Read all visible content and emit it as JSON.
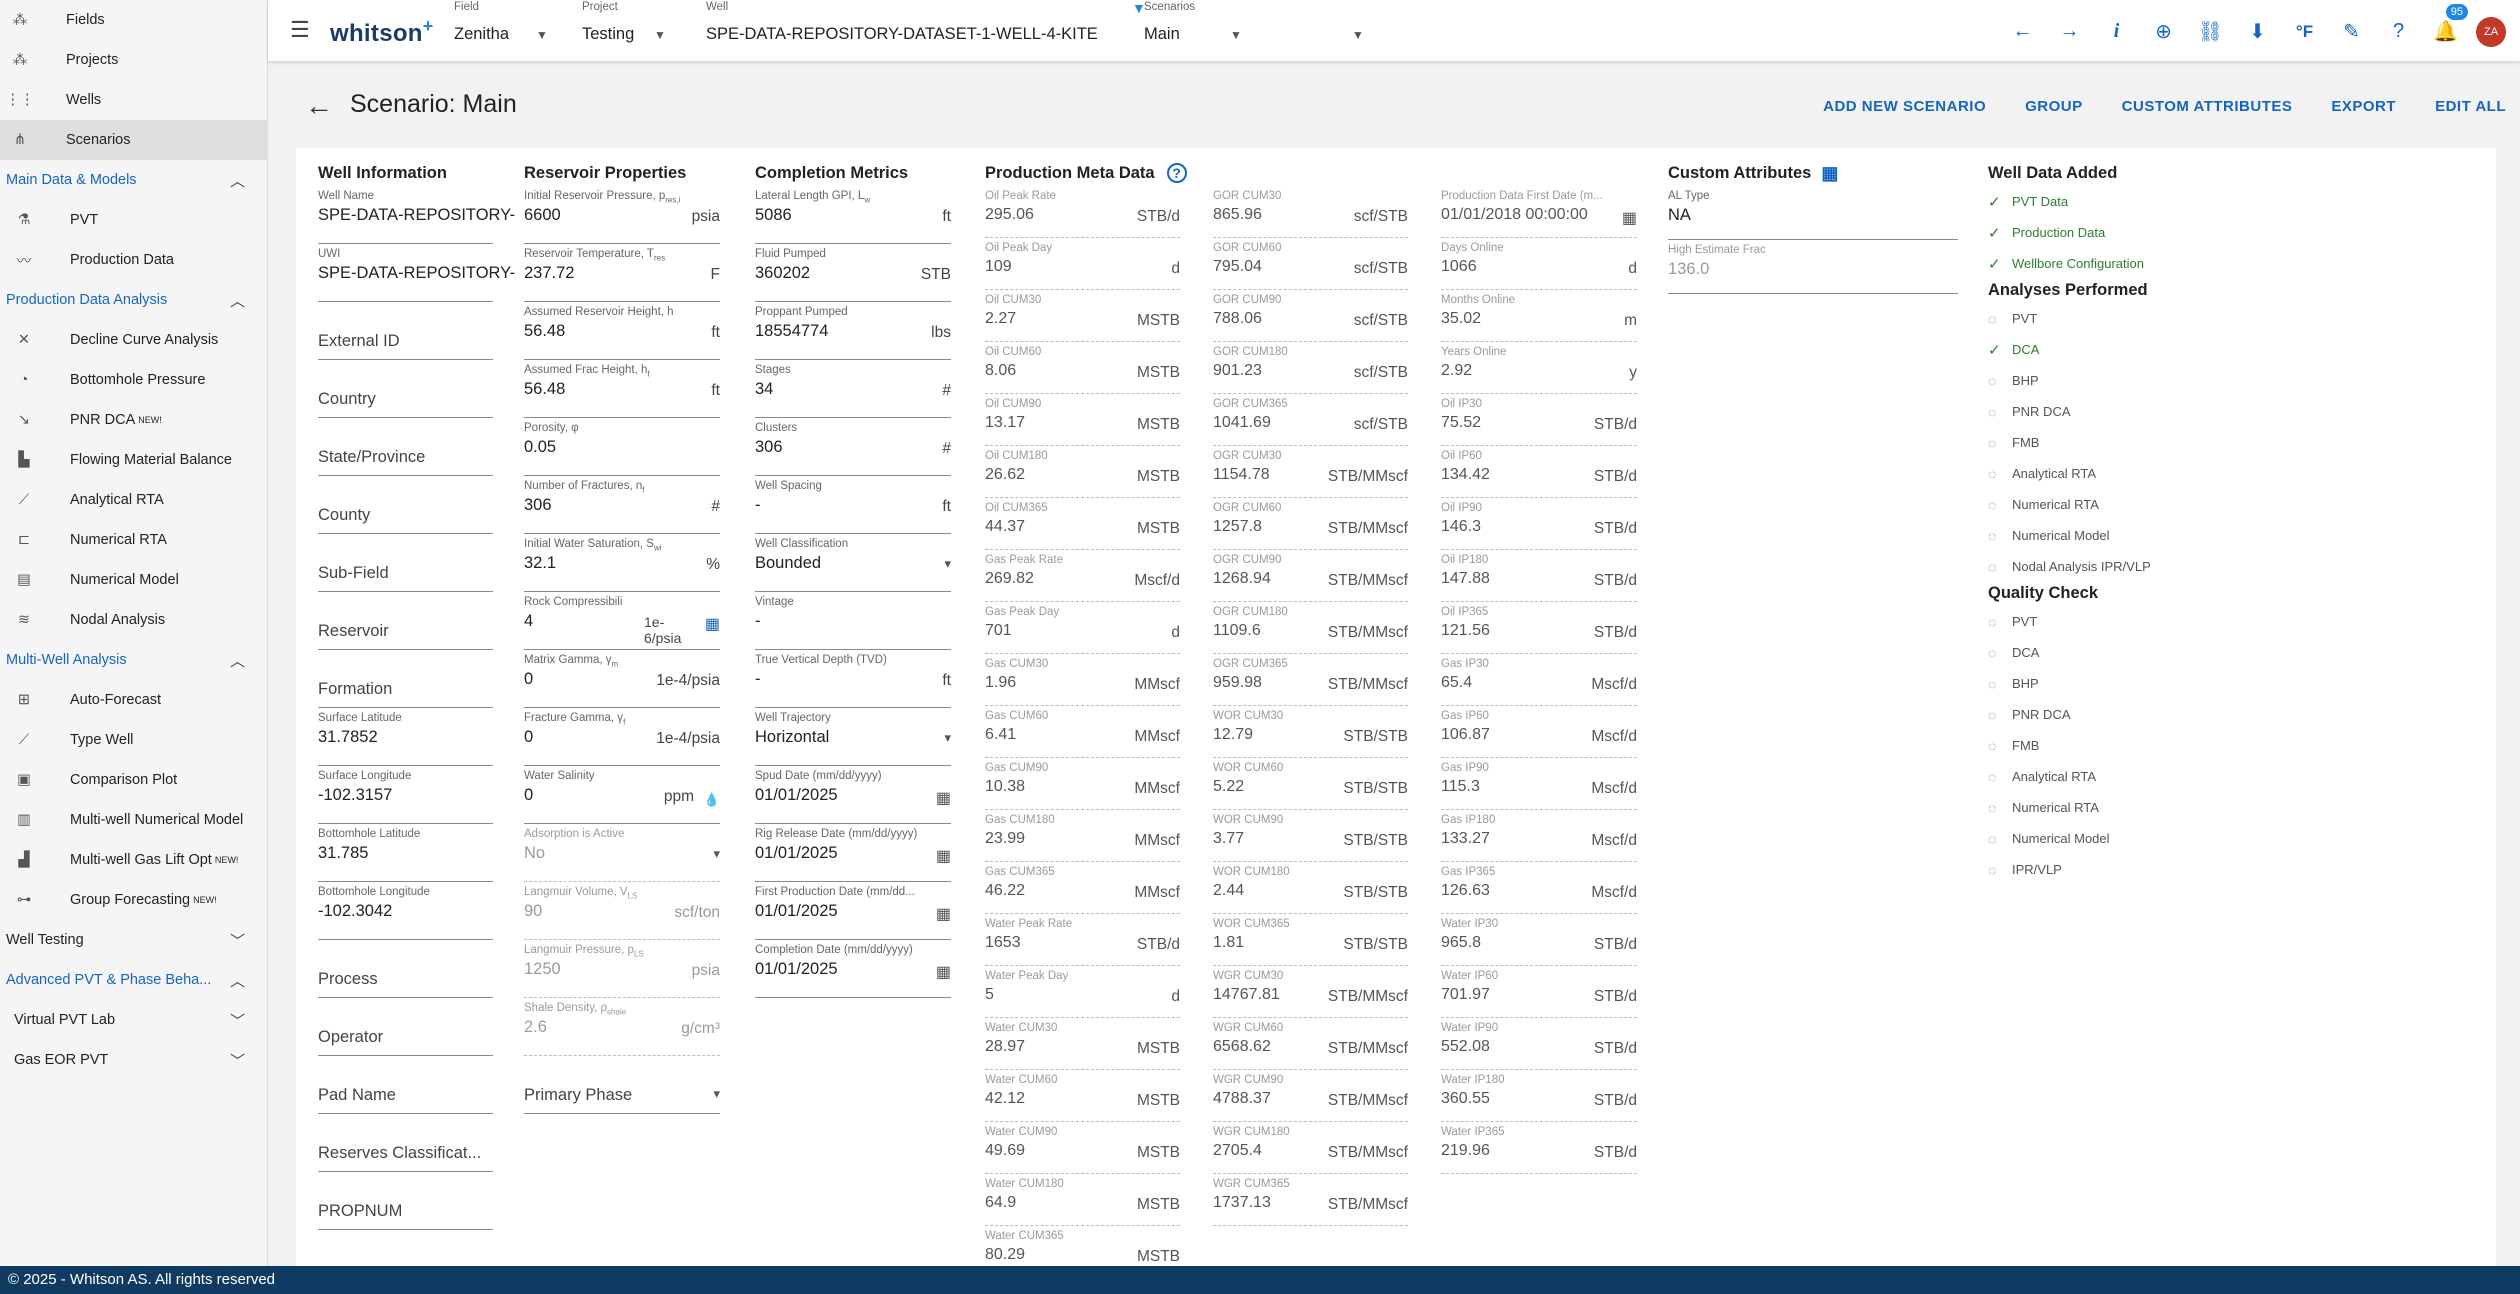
{
  "sidebar": {
    "top": [
      {
        "label": "Fields",
        "icon": "fields-icon"
      },
      {
        "label": "Projects",
        "icon": "projects-icon"
      },
      {
        "label": "Wells",
        "icon": "wells-icon"
      },
      {
        "label": "Scenarios",
        "icon": "scenarios-icon"
      }
    ],
    "main_data": {
      "label": "Main Data & Models",
      "items": [
        {
          "label": "PVT",
          "icon": "flask-icon"
        },
        {
          "label": "Production Data",
          "icon": "trend-icon"
        }
      ]
    },
    "pda": {
      "label": "Production Data Analysis",
      "items": [
        {
          "label": "Decline Curve Analysis",
          "icon": "dca-icon"
        },
        {
          "label": "Bottomhole Pressure",
          "icon": "gauge-icon"
        },
        {
          "label": "PNR DCA",
          "icon": "pnr-icon",
          "sup": "NEW!"
        },
        {
          "label": "Flowing Material Balance",
          "icon": "chart-icon"
        },
        {
          "label": "Analytical RTA",
          "icon": "line-icon"
        },
        {
          "label": "Numerical RTA",
          "icon": "numrta-icon"
        },
        {
          "label": "Numerical Model",
          "icon": "grid-icon"
        },
        {
          "label": "Nodal Analysis",
          "icon": "nodal-icon"
        }
      ]
    },
    "mwa": {
      "label": "Multi-Well Analysis",
      "items": [
        {
          "label": "Auto-Forecast",
          "icon": "apps-icon"
        },
        {
          "label": "Type Well",
          "icon": "typewell-icon"
        },
        {
          "label": "Comparison Plot",
          "icon": "comparison-icon"
        },
        {
          "label": "Multi-well Numerical Model",
          "icon": "multiwell-icon"
        },
        {
          "label": "Multi-well Gas Lift Opt",
          "icon": "gaslift-icon",
          "sup": "NEW!"
        },
        {
          "label": "Group Forecasting",
          "icon": "group-icon",
          "sup": "NEW!"
        }
      ]
    },
    "well_testing": "Well Testing",
    "adv_pvt": "Advanced PVT & Phase Beha...",
    "virtual_pvt": "Virtual PVT Lab",
    "gas_eor": "Gas EOR PVT"
  },
  "topbar": {
    "logo": "whitson",
    "logo_plus": "+",
    "field_label": "Field",
    "field": "Zenitha",
    "project_label": "Project",
    "project": "Testing",
    "well_label": "Well",
    "well": "SPE-DATA-REPOSITORY-DATASET-1-WELL-4-KITE",
    "scen_label": "Scenarios",
    "scenario": "Main",
    "notifications": "95",
    "avatar": "ZA",
    "unit": "°F"
  },
  "header": {
    "title": "Scenario: Main",
    "actions": [
      "ADD NEW SCENARIO",
      "GROUP",
      "CUSTOM ATTRIBUTES",
      "EXPORT",
      "EDIT ALL"
    ]
  },
  "well_info": {
    "title": "Well Information",
    "fields": [
      {
        "l": "Well Name",
        "v": "SPE-DATA-REPOSITORY-"
      },
      {
        "l": "UWI",
        "v": "SPE-DATA-REPOSITORY-"
      },
      {
        "p": "External ID"
      },
      {
        "p": "Country"
      },
      {
        "p": "State/Province"
      },
      {
        "p": "County"
      },
      {
        "p": "Sub-Field"
      },
      {
        "p": "Reservoir"
      },
      {
        "p": "Formation"
      },
      {
        "l": "Surface Latitude",
        "v": "31.7852"
      },
      {
        "l": "Surface Longitude",
        "v": "-102.3157"
      },
      {
        "l": "Bottomhole Latitude",
        "v": "31.785"
      },
      {
        "l": "Bottomhole Longitude",
        "v": "-102.3042"
      },
      {
        "p": "Process"
      },
      {
        "p": "Operator"
      },
      {
        "p": "Pad Name"
      },
      {
        "p": "Reserves Classificat..."
      },
      {
        "p": "PROPNUM"
      }
    ]
  },
  "reservoir": {
    "title": "Reservoir Properties",
    "fields": [
      {
        "l": "Initial Reservoir Pressure, p",
        "sub": "res,i",
        "v": "6600",
        "u": "psia"
      },
      {
        "l": "Reservoir Temperature, T",
        "sub": "res",
        "v": "237.72",
        "u": "F"
      },
      {
        "l": "Assumed Reservoir Height, h",
        "v": "56.48",
        "u": "ft"
      },
      {
        "l": "Assumed Frac Height, h",
        "sub": "f",
        "v": "56.48",
        "u": "ft"
      },
      {
        "l": "Porosity, φ",
        "v": "0.05",
        "u": ""
      },
      {
        "l": "Number of Fractures, n",
        "sub": "f",
        "v": "306",
        "u": "#"
      },
      {
        "l": "Initial Water Saturation, S",
        "sub": "wi",
        "v": "32.1",
        "u": "%"
      },
      {
        "l": "Rock Compressibili",
        "v": "4",
        "u": "1e-6/psia",
        "calc": true
      },
      {
        "l": "Matrix Gamma, γ",
        "sub": "m",
        "v": "0",
        "u": "1e-4/psia"
      },
      {
        "l": "Fracture Gamma, γ",
        "sub": "f",
        "v": "0",
        "u": "1e-4/psia"
      },
      {
        "l": "Water Salinity",
        "v": "0",
        "u": "ppm",
        "drop": true
      },
      {
        "l": "Adsorption is Active",
        "v": "No",
        "dis": true,
        "sel": true
      },
      {
        "l": "Langmuir Volume, V",
        "sub": "LS",
        "v": "90",
        "u": "scf/ton",
        "dis": true
      },
      {
        "l": "Langmuir Pressure, p",
        "sub": "LS",
        "v": "1250",
        "u": "psia",
        "dis": true
      },
      {
        "l": "Shale Density, ρ",
        "sub": "shale",
        "v": "2.6",
        "u": "g/cm³",
        "dis": true
      },
      {
        "p": "Primary Phase",
        "sel": true
      }
    ]
  },
  "completion": {
    "title": "Completion Metrics",
    "fields": [
      {
        "l": "Lateral Length GPI, L",
        "sub": "w",
        "v": "5086",
        "u": "ft"
      },
      {
        "l": "Fluid Pumped",
        "v": "360202",
        "u": "STB"
      },
      {
        "l": "Proppant Pumped",
        "v": "18554774",
        "u": "lbs"
      },
      {
        "l": "Stages",
        "v": "34",
        "u": "#"
      },
      {
        "l": "Clusters",
        "v": "306",
        "u": "#"
      },
      {
        "l": "Well Spacing",
        "v": "-",
        "u": "ft"
      },
      {
        "l": "Well Classification",
        "v": "Bounded",
        "sel": true
      },
      {
        "l": "Vintage",
        "v": "-"
      },
      {
        "l": "True Vertical Depth (TVD)",
        "v": "-",
        "u": "ft"
      },
      {
        "l": "Well Trajectory",
        "v": "Horizontal",
        "sel": true
      },
      {
        "l": "Spud Date (mm/dd/yyyy)",
        "v": "01/01/2025",
        "cal": true
      },
      {
        "l": "Rig Release Date (mm/dd/yyyy)",
        "v": "01/01/2025",
        "cal": true
      },
      {
        "l": "First Production Date (mm/dd...",
        "v": "01/01/2025",
        "cal": true
      },
      {
        "l": "Completion Date (mm/dd/yyyy)",
        "v": "01/01/2025",
        "cal": true
      }
    ]
  },
  "pmd": {
    "title": "Production Meta Data",
    "c1": [
      {
        "l": "Oil Peak Rate",
        "v": "295.06",
        "u": "STB/d"
      },
      {
        "l": "Oil Peak Day",
        "v": "109",
        "u": "d"
      },
      {
        "l": "Oil CUM30",
        "v": "2.27",
        "u": "MSTB"
      },
      {
        "l": "Oil CUM60",
        "v": "8.06",
        "u": "MSTB"
      },
      {
        "l": "Oil CUM90",
        "v": "13.17",
        "u": "MSTB"
      },
      {
        "l": "Oil CUM180",
        "v": "26.62",
        "u": "MSTB"
      },
      {
        "l": "Oil CUM365",
        "v": "44.37",
        "u": "MSTB"
      },
      {
        "l": "Gas Peak Rate",
        "v": "269.82",
        "u": "Mscf/d"
      },
      {
        "l": "Gas Peak Day",
        "v": "701",
        "u": "d"
      },
      {
        "l": "Gas CUM30",
        "v": "1.96",
        "u": "MMscf"
      },
      {
        "l": "Gas CUM60",
        "v": "6.41",
        "u": "MMscf"
      },
      {
        "l": "Gas CUM90",
        "v": "10.38",
        "u": "MMscf"
      },
      {
        "l": "Gas CUM180",
        "v": "23.99",
        "u": "MMscf"
      },
      {
        "l": "Gas CUM365",
        "v": "46.22",
        "u": "MMscf"
      },
      {
        "l": "Water Peak Rate",
        "v": "1653",
        "u": "STB/d"
      },
      {
        "l": "Water Peak Day",
        "v": "5",
        "u": "d"
      },
      {
        "l": "Water CUM30",
        "v": "28.97",
        "u": "MSTB"
      },
      {
        "l": "Water CUM60",
        "v": "42.12",
        "u": "MSTB"
      },
      {
        "l": "Water CUM90",
        "v": "49.69",
        "u": "MSTB"
      },
      {
        "l": "Water CUM180",
        "v": "64.9",
        "u": "MSTB"
      },
      {
        "l": "Water CUM365",
        "v": "80.29",
        "u": "MSTB"
      }
    ],
    "c2": [
      {
        "l": "GOR CUM30",
        "v": "865.96",
        "u": "scf/STB"
      },
      {
        "l": "GOR CUM60",
        "v": "795.04",
        "u": "scf/STB"
      },
      {
        "l": "GOR CUM90",
        "v": "788.06",
        "u": "scf/STB"
      },
      {
        "l": "GOR CUM180",
        "v": "901.23",
        "u": "scf/STB"
      },
      {
        "l": "GOR CUM365",
        "v": "1041.69",
        "u": "scf/STB"
      },
      {
        "l": "OGR CUM30",
        "v": "1154.78",
        "u": "STB/MMscf"
      },
      {
        "l": "OGR CUM60",
        "v": "1257.8",
        "u": "STB/MMscf"
      },
      {
        "l": "OGR CUM90",
        "v": "1268.94",
        "u": "STB/MMscf"
      },
      {
        "l": "OGR CUM180",
        "v": "1109.6",
        "u": "STB/MMscf"
      },
      {
        "l": "OGR CUM365",
        "v": "959.98",
        "u": "STB/MMscf"
      },
      {
        "l": "WOR CUM30",
        "v": "12.79",
        "u": "STB/STB"
      },
      {
        "l": "WOR CUM60",
        "v": "5.22",
        "u": "STB/STB"
      },
      {
        "l": "WOR CUM90",
        "v": "3.77",
        "u": "STB/STB"
      },
      {
        "l": "WOR CUM180",
        "v": "2.44",
        "u": "STB/STB"
      },
      {
        "l": "WOR CUM365",
        "v": "1.81",
        "u": "STB/STB"
      },
      {
        "l": "WGR CUM30",
        "v": "14767.81",
        "u": "STB/MMscf"
      },
      {
        "l": "WGR CUM60",
        "v": "6568.62",
        "u": "STB/MMscf"
      },
      {
        "l": "WGR CUM90",
        "v": "4788.37",
        "u": "STB/MMscf"
      },
      {
        "l": "WGR CUM180",
        "v": "2705.4",
        "u": "STB/MMscf"
      },
      {
        "l": "WGR CUM365",
        "v": "1737.13",
        "u": "STB/MMscf"
      }
    ],
    "c3": [
      {
        "l": "Production Data First Date (m...",
        "v": "01/01/2018 00:00:00",
        "cal": true
      },
      {
        "l": "Days Online",
        "v": "1066",
        "u": "d"
      },
      {
        "l": "Months Online",
        "v": "35.02",
        "u": "m"
      },
      {
        "l": "Years Online",
        "v": "2.92",
        "u": "y"
      },
      {
        "l": "Oil IP30",
        "v": "75.52",
        "u": "STB/d"
      },
      {
        "l": "Oil IP60",
        "v": "134.42",
        "u": "STB/d"
      },
      {
        "l": "Oil IP90",
        "v": "146.3",
        "u": "STB/d"
      },
      {
        "l": "Oil IP180",
        "v": "147.88",
        "u": "STB/d"
      },
      {
        "l": "Oil IP365",
        "v": "121.56",
        "u": "STB/d"
      },
      {
        "l": "Gas IP30",
        "v": "65.4",
        "u": "Mscf/d"
      },
      {
        "l": "Gas IP60",
        "v": "106.87",
        "u": "Mscf/d"
      },
      {
        "l": "Gas IP90",
        "v": "115.3",
        "u": "Mscf/d"
      },
      {
        "l": "Gas IP180",
        "v": "133.27",
        "u": "Mscf/d"
      },
      {
        "l": "Gas IP365",
        "v": "126.63",
        "u": "Mscf/d"
      },
      {
        "l": "Water IP30",
        "v": "965.8",
        "u": "STB/d"
      },
      {
        "l": "Water IP60",
        "v": "701.97",
        "u": "STB/d"
      },
      {
        "l": "Water IP90",
        "v": "552.08",
        "u": "STB/d"
      },
      {
        "l": "Water IP180",
        "v": "360.55",
        "u": "STB/d"
      },
      {
        "l": "Water IP365",
        "v": "219.96",
        "u": "STB/d"
      }
    ]
  },
  "custom": {
    "title": "Custom Attributes",
    "fields": [
      {
        "l": "AL Type",
        "v": "NA"
      },
      {
        "l": "High Estimate Frac",
        "v": "136.0",
        "dis": true
      }
    ]
  },
  "well_data": {
    "title": "Well Data Added",
    "items": [
      "PVT Data",
      "Production Data",
      "Wellbore Configuration"
    ]
  },
  "analyses": {
    "title": "Analyses Performed",
    "items": [
      {
        "t": "PVT",
        "d": false
      },
      {
        "t": "DCA",
        "d": true
      },
      {
        "t": "BHP",
        "d": false
      },
      {
        "t": "PNR DCA",
        "d": false
      },
      {
        "t": "FMB",
        "d": false
      },
      {
        "t": "Analytical RTA",
        "d": false
      },
      {
        "t": "Numerical RTA",
        "d": false
      },
      {
        "t": "Numerical Model",
        "d": false
      },
      {
        "t": "Nodal Analysis IPR/VLP",
        "d": false
      }
    ]
  },
  "quality": {
    "title": "Quality Check",
    "items": [
      "PVT",
      "DCA",
      "BHP",
      "PNR DCA",
      "FMB",
      "Analytical RTA",
      "Numerical RTA",
      "Numerical Model",
      "IPR/VLP"
    ]
  },
  "footer": "© 2025 - Whitson AS. All rights reserved"
}
